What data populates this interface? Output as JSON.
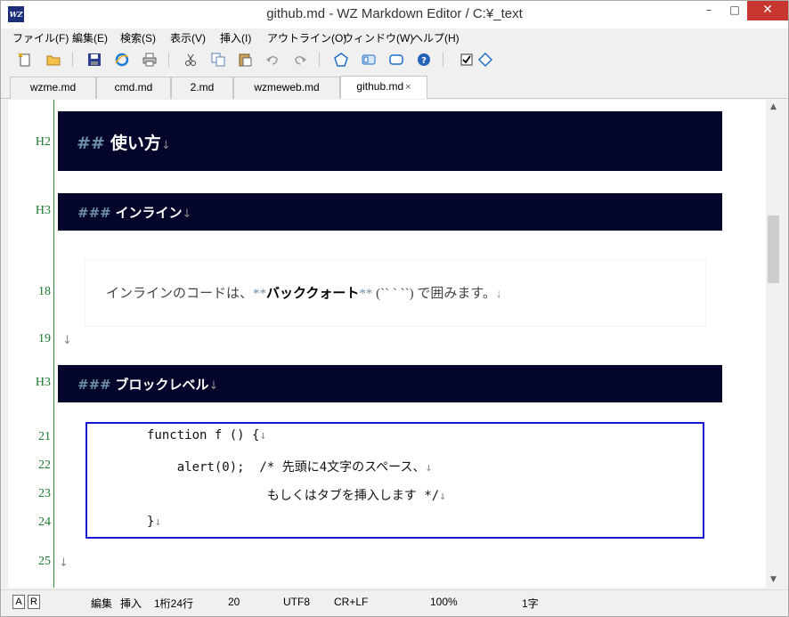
{
  "window": {
    "title": "github.md - WZ Markdown Editor / C:¥_text",
    "app_icon": "WZ",
    "minimize": "–",
    "maximize": "□",
    "close": "✕"
  },
  "menu": [
    "ファイル(F)",
    "編集(E)",
    "検索(S)",
    "表示(V)",
    "挿入(I)",
    "アウトライン(O)",
    "ウィンドウ(W)",
    "ヘルプ(H)"
  ],
  "toolbar_icons": [
    "new-file-icon",
    "open-folder-icon",
    "save-icon",
    "browser-icon",
    "print-icon",
    "cut-icon",
    "copy-icon",
    "paste-icon",
    "undo-icon",
    "redo-icon",
    "pentagon-icon",
    "panel-icon",
    "rounded-rect-icon",
    "help-icon",
    "checkbox-icon",
    "diamond-icon"
  ],
  "tabs": [
    {
      "label": "wzme.md",
      "active": false
    },
    {
      "label": "cmd.md",
      "active": false
    },
    {
      "label": "2.md",
      "active": false
    },
    {
      "label": "wzmeweb.md",
      "active": false
    },
    {
      "label": "github.md",
      "active": true
    }
  ],
  "tab_close": "×",
  "editor": {
    "eol": "↓",
    "lines": [
      {
        "num": "H2",
        "marks": "##",
        "text": "使い方"
      },
      {
        "num": "H3",
        "marks": "###",
        "text": "インライン"
      },
      {
        "num": "18",
        "pre": "インラインのコードは、",
        "bold_mark": "**",
        "bold": "バッククォート",
        "post": " (`` ` ``) で囲みます。"
      },
      {
        "num": "19"
      },
      {
        "num": "H3",
        "marks": "###",
        "text": "ブロックレベル"
      },
      {
        "num": "21",
        "code": "function f () {"
      },
      {
        "num": "22",
        "code": "    alert(0);  /* 先頭に4文字のスペース、"
      },
      {
        "num": "23",
        "code": "                もしくはタブを挿入します */"
      },
      {
        "num": "24",
        "code": "}"
      },
      {
        "num": "25"
      }
    ]
  },
  "statusbar": {
    "box_a": "A",
    "box_r": "R",
    "mode": "編集",
    "insert": "挿入",
    "position": "1桁24行",
    "value": "20",
    "encoding": "UTF8",
    "newline": "CR+LF",
    "zoom": "100%",
    "chars": "1字"
  },
  "colors": {
    "heading_bg": "#03052a",
    "heading_marks": "#6d8fa6",
    "line_number": "#1a7a2c",
    "code_border": "#1818d0",
    "close_button": "#c7372f"
  }
}
